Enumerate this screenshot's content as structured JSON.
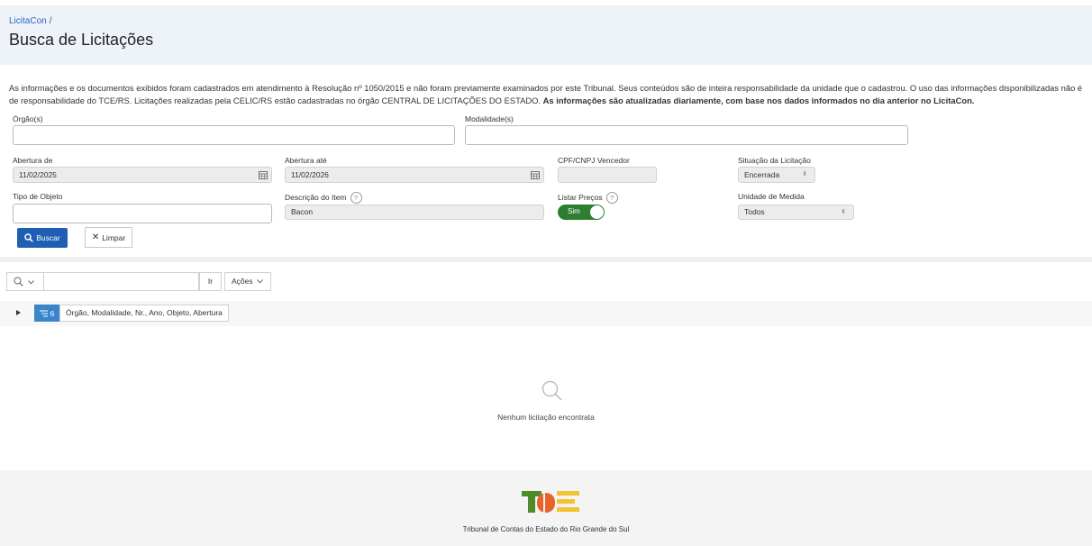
{
  "header": {
    "breadcrumb": "LicitaCon",
    "breadcrumb_sep": "/",
    "title": "Busca de Licitações"
  },
  "notice": {
    "text": "As informações e os documentos exibidos foram cadastrados em atendimento à Resolução nº 1050/2015 e não foram previamente examinados por este Tribunal. Seus conteúdos são de inteira responsabilidade da unidade que o cadastrou. O uso das informações disponibilizadas não é de responsabilidade do TCE/RS. Licitações realizadas pela CELIC/RS estão cadastradas no órgão CENTRAL DE LICITAÇÕES DO ESTADO.",
    "bold": "As informações são atualizadas diariamente, com base nos dados informados no dia anterior no LicitaCon."
  },
  "form": {
    "orgao_label": "Órgão(s)",
    "orgao_value": "",
    "modalidade_label": "Modalidade(s)",
    "modalidade_value": "",
    "abertura_de_label": "Abertura de",
    "abertura_de_value": "11/02/2025",
    "abertura_ate_label": "Abertura até",
    "abertura_ate_value": "11/02/2026",
    "cpf_label": "CPF/CNPJ Vencedor",
    "cpf_value": "",
    "situacao_label": "Situação da Licitação",
    "situacao_value": "Encerrada",
    "tipo_objeto_label": "Tipo de Objeto",
    "tipo_objeto_value": "",
    "descricao_label": "Descrição do Item",
    "descricao_value": "Bacon",
    "listar_precos_label": "Listar Preços",
    "listar_precos_value": "Sim",
    "unidade_label": "Unidade de Medida",
    "unidade_value": "Todos",
    "help_glyph": "?"
  },
  "actions": {
    "buscar": "Buscar",
    "limpar": "Limpar"
  },
  "report": {
    "go_label": "Ir",
    "actions_label": "Ações",
    "columns_count": "6",
    "columns_text": "Órgão, Modalidade, Nr., Ano, Objeto, Abertura",
    "empty_message": "Nenhum licitação encontrata"
  },
  "footer": {
    "org_name": "Tribunal de Contas do Estado do Rio Grande do Sul"
  },
  "colors": {
    "primary": "#1e5fb4",
    "toggle_on": "#2e7d32",
    "header_bg": "#eef2f9",
    "logo_green": "#4c8c2b",
    "logo_orange": "#e8622a",
    "logo_yellow": "#f2c230"
  }
}
